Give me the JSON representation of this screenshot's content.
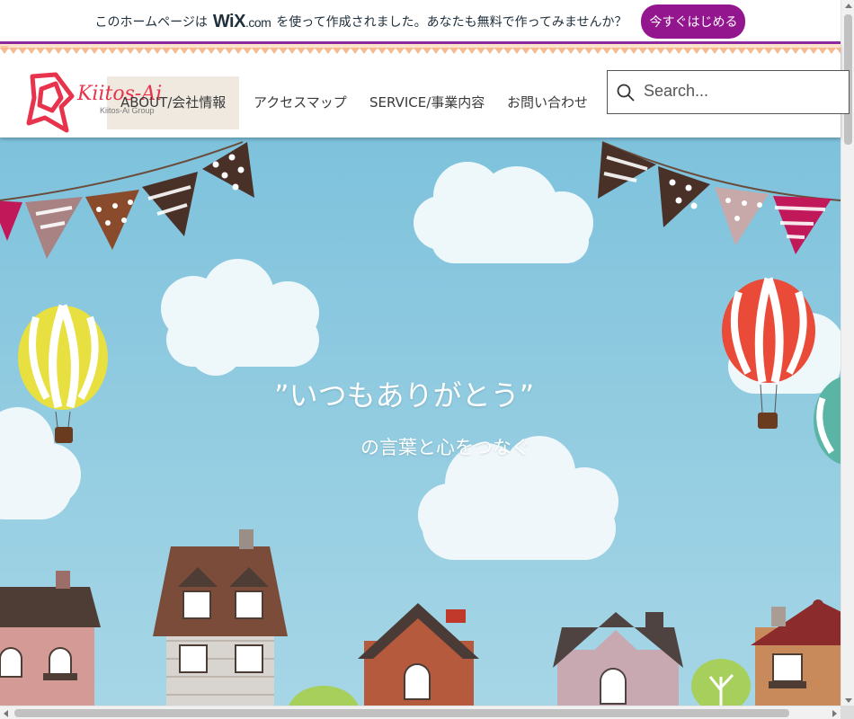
{
  "wix_banner": {
    "text_before": "このホームページは",
    "wix_logo": "WiX",
    "wix_logo_suffix": ".com",
    "text_after": "を使って作成されました。あなたも無料で作ってみませんか？",
    "cta_label": "今すぐはじめる"
  },
  "header": {
    "logo_text": "Kiitos-Ai",
    "logo_subtext": "Kiitos-Ai Group",
    "nav": [
      {
        "label": "ABOUT/会社情報"
      },
      {
        "label": "アクセスマップ"
      },
      {
        "label": "SERVICE/事業内容"
      },
      {
        "label": "お問い合わせ"
      }
    ],
    "search_placeholder": "Search..."
  },
  "hero": {
    "line1": "”いつもありがとう”",
    "line2": "の言葉と心をつなぐ"
  },
  "colors": {
    "wix_cta": "#94168f",
    "accent_purple": "#8f2aa0",
    "sky": "#86c6dc",
    "logo_red": "#e8334d"
  }
}
